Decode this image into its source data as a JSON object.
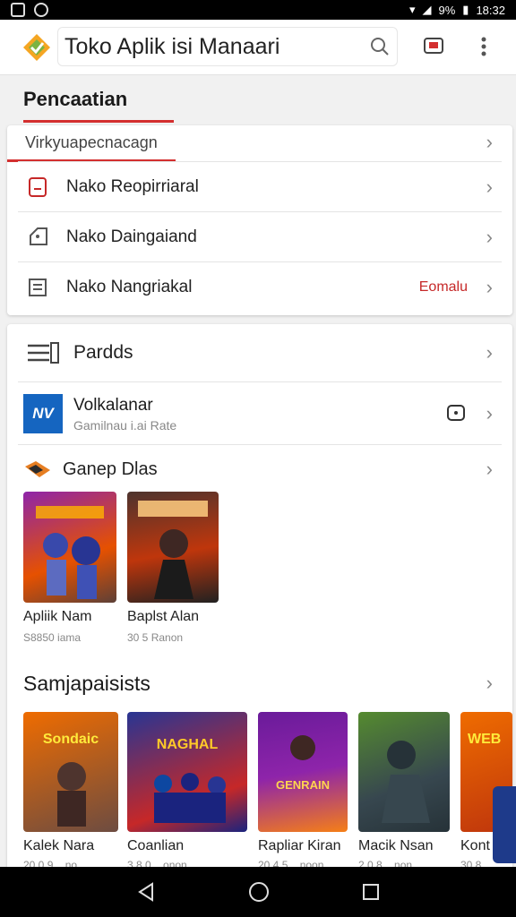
{
  "status": {
    "battery": "9%",
    "time": "18:32"
  },
  "toolbar": {
    "title": "Toko Aplik isi Manaari"
  },
  "section_heading": "Pencaatian",
  "menu": {
    "search_hint": "Virkyuapecnacagn",
    "items": [
      {
        "label": "Nako Reopirriaral",
        "icon": "device-icon"
      },
      {
        "label": "Nako Daingaiand",
        "icon": "tag-icon"
      },
      {
        "label": "Nako Nangriakal",
        "icon": "document-icon",
        "badge": "Eomalu"
      }
    ]
  },
  "feed": {
    "pardds_label": "Pardds",
    "app_row": {
      "name": "Volkalanar",
      "subtitle": "Gamilnau i.ai Rate",
      "logo_text": "NV"
    },
    "games_header": "Ganep Dlas",
    "games": [
      {
        "title": "Apliik Nam",
        "subtitle": "S8850 iama"
      },
      {
        "title": "Baplst Alan",
        "subtitle": "30 5 Ranon"
      }
    ],
    "section2_title": "Samjapaisists",
    "row2": [
      {
        "title": "Kalek Nara",
        "subtitle": "20 0 9 ...no",
        "art_text": "Sondaic"
      },
      {
        "title": "Coanlian",
        "subtitle": "3 8 0 ...onon",
        "art_text": "NAGHAL"
      },
      {
        "title": "Rapliar Kiran",
        "subtitle": "20 4 5 ...noon",
        "art_text": "GENRAIN"
      },
      {
        "title": "Macik Nsan",
        "subtitle": "2 0 8 ...non",
        "art_text": ""
      },
      {
        "title": "Kont",
        "subtitle": "30 8",
        "art_text": "WEB"
      }
    ]
  },
  "colors": {
    "accent": "#d32f2f",
    "nav_bg": "#000000"
  }
}
